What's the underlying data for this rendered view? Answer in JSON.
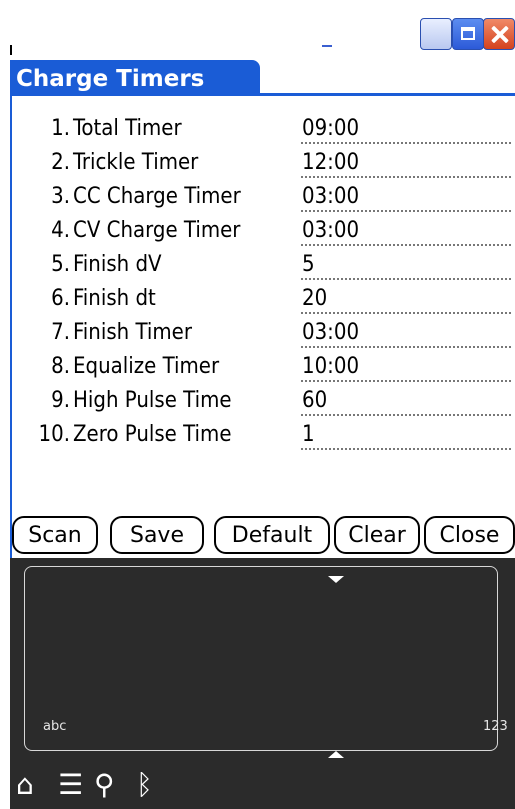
{
  "window": {
    "buttons": [
      "minimize",
      "maximize",
      "close"
    ]
  },
  "form": {
    "title": "Charge Timers",
    "rows": [
      {
        "num": "1.",
        "label": "Total Timer",
        "value": "09:00"
      },
      {
        "num": "2.",
        "label": "Trickle Timer",
        "value": "12:00"
      },
      {
        "num": "3.",
        "label": "CC Charge Timer",
        "value": "03:00"
      },
      {
        "num": "4.",
        "label": "CV Charge Timer",
        "value": "03:00"
      },
      {
        "num": "5.",
        "label": "Finish dV",
        "value": "5"
      },
      {
        "num": "6.",
        "label": "Finish dt",
        "value": "20"
      },
      {
        "num": "7.",
        "label": "Finish Timer",
        "value": "03:00"
      },
      {
        "num": "8.",
        "label": "Equalize Timer",
        "value": "10:00"
      },
      {
        "num": "9.",
        "label": "High Pulse Time",
        "value": "60"
      },
      {
        "num": "10.",
        "label": "Zero Pulse Time",
        "value": "1"
      }
    ]
  },
  "buttons": {
    "scan": "Scan",
    "save": "Save",
    "default": "Default",
    "clear": "Clear",
    "close": "Close"
  },
  "graffiti": {
    "alpha_label": "abc",
    "numeric_label": "123"
  },
  "status_icons": [
    "home-icon",
    "menu-icon",
    "find-icon",
    "bluetooth-icon"
  ],
  "colors": {
    "accent": "#1a5cd6",
    "graffiti_bg": "#2b2b2b"
  }
}
